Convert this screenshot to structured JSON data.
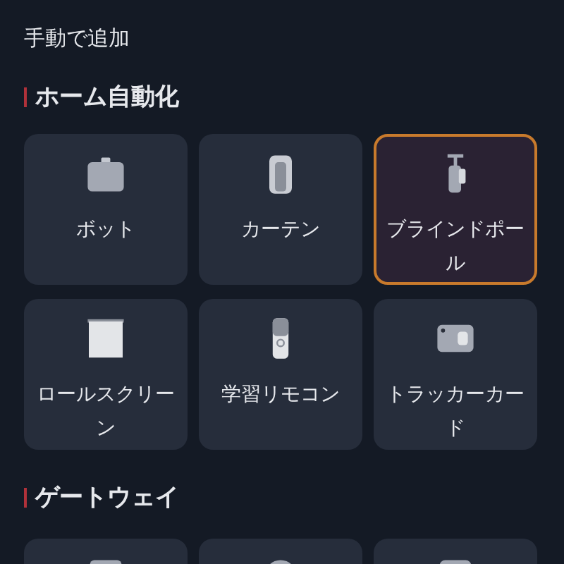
{
  "page_title": "手動で追加",
  "sections": [
    {
      "title": "ホーム自動化",
      "items": [
        {
          "label": "ボット",
          "selected": false
        },
        {
          "label": "カーテン",
          "selected": false
        },
        {
          "label": "ブラインドポール",
          "selected": true
        },
        {
          "label": "ロールスクリーン",
          "selected": false
        },
        {
          "label": "学習リモコン",
          "selected": false
        },
        {
          "label": "トラッカーカード",
          "selected": false
        }
      ]
    },
    {
      "title": "ゲートウェイ",
      "items": [
        {
          "selected": false
        },
        {
          "selected": false
        },
        {
          "selected": false
        }
      ]
    }
  ]
}
